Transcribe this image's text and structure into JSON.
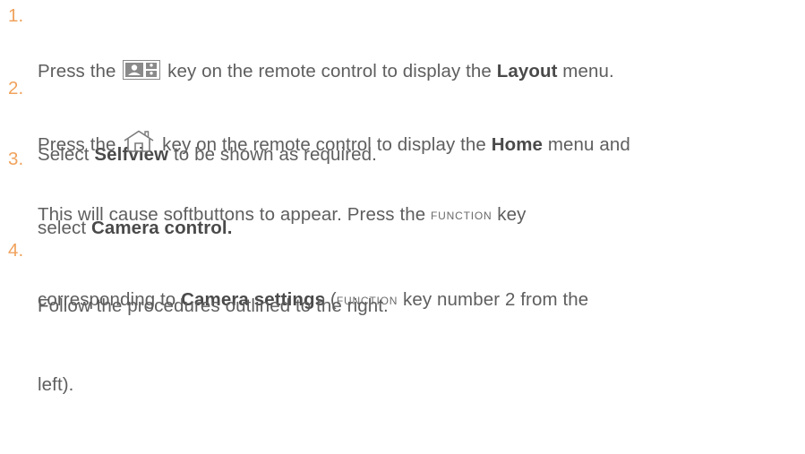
{
  "steps": [
    {
      "number": "1.",
      "line1": {
        "t1": "Press the ",
        "icon": "layout-icon",
        "t2": " key on the remote control to display the ",
        "b1": "Layout",
        "t3": " menu."
      },
      "line2": {
        "t1": "Select ",
        "b1": "Selfview",
        "t2": " to be shown as required."
      }
    },
    {
      "number": "2.",
      "line1": {
        "t1": "Press the ",
        "icon": "home-icon",
        "t2": " key on the remote control to display the ",
        "b1": "Home",
        "t3": " menu and"
      },
      "line2": {
        "t1": "select ",
        "b1": "Camera control."
      }
    },
    {
      "number": "3.",
      "line1": {
        "t1": "This will cause softbuttons to appear. Press the ",
        "sc1": "FUNCTION",
        "t2": " key"
      },
      "line2": {
        "t1": "corresponding to ",
        "b1": "Camera settings",
        "t2": " (",
        "sc1": "FUNCTION",
        "t3": " key number 2 from the"
      },
      "line3": {
        "t1": "left)."
      }
    },
    {
      "number": "4.",
      "line1": {
        "t1": "Follow the procedures outlined to the right."
      }
    }
  ]
}
